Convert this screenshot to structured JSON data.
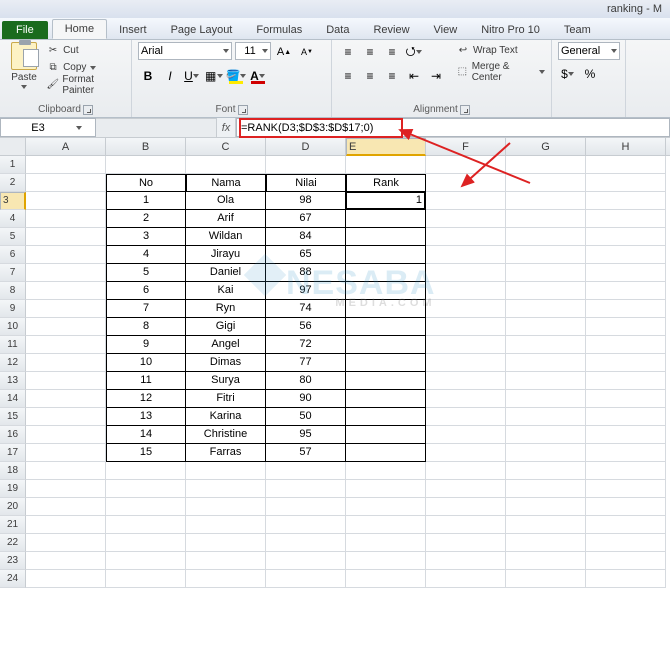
{
  "window_title": "ranking - M",
  "tabs": {
    "file": "File",
    "home": "Home",
    "insert": "Insert",
    "page_layout": "Page Layout",
    "formulas": "Formulas",
    "data": "Data",
    "review": "Review",
    "view": "View",
    "nitro": "Nitro Pro 10",
    "team": "Team"
  },
  "clipboard": {
    "paste": "Paste",
    "cut": "Cut",
    "copy": "Copy",
    "format_painter": "Format Painter",
    "label": "Clipboard"
  },
  "font": {
    "name": "Arial",
    "size": "11",
    "label": "Font"
  },
  "alignment": {
    "wrap": "Wrap Text",
    "merge": "Merge & Center",
    "label": "Alignment"
  },
  "number": {
    "format": "General"
  },
  "namebox": "E3",
  "formula": "=RANK(D3;$D$3:$D$17;0)",
  "columns": [
    "A",
    "B",
    "C",
    "D",
    "E",
    "F",
    "G",
    "H"
  ],
  "headers": {
    "no": "No",
    "nama": "Nama",
    "nilai": "Nilai",
    "rank": "Rank"
  },
  "e3_value": "1",
  "chart_data": {
    "type": "table",
    "columns": [
      "No",
      "Nama",
      "Nilai"
    ],
    "rows": [
      [
        1,
        "Ola",
        98
      ],
      [
        2,
        "Arif",
        67
      ],
      [
        3,
        "Wildan",
        84
      ],
      [
        4,
        "Jirayu",
        65
      ],
      [
        5,
        "Daniel",
        88
      ],
      [
        6,
        "Kai",
        97
      ],
      [
        7,
        "Ryn",
        74
      ],
      [
        8,
        "Gigi",
        56
      ],
      [
        9,
        "Angel",
        72
      ],
      [
        10,
        "Dimas",
        77
      ],
      [
        11,
        "Surya",
        80
      ],
      [
        12,
        "Fitri",
        90
      ],
      [
        13,
        "Karina",
        50
      ],
      [
        14,
        "Christine",
        95
      ],
      [
        15,
        "Farras",
        57
      ]
    ]
  },
  "watermark": "NESABA",
  "watermark_sub": "MEDIA.COM"
}
